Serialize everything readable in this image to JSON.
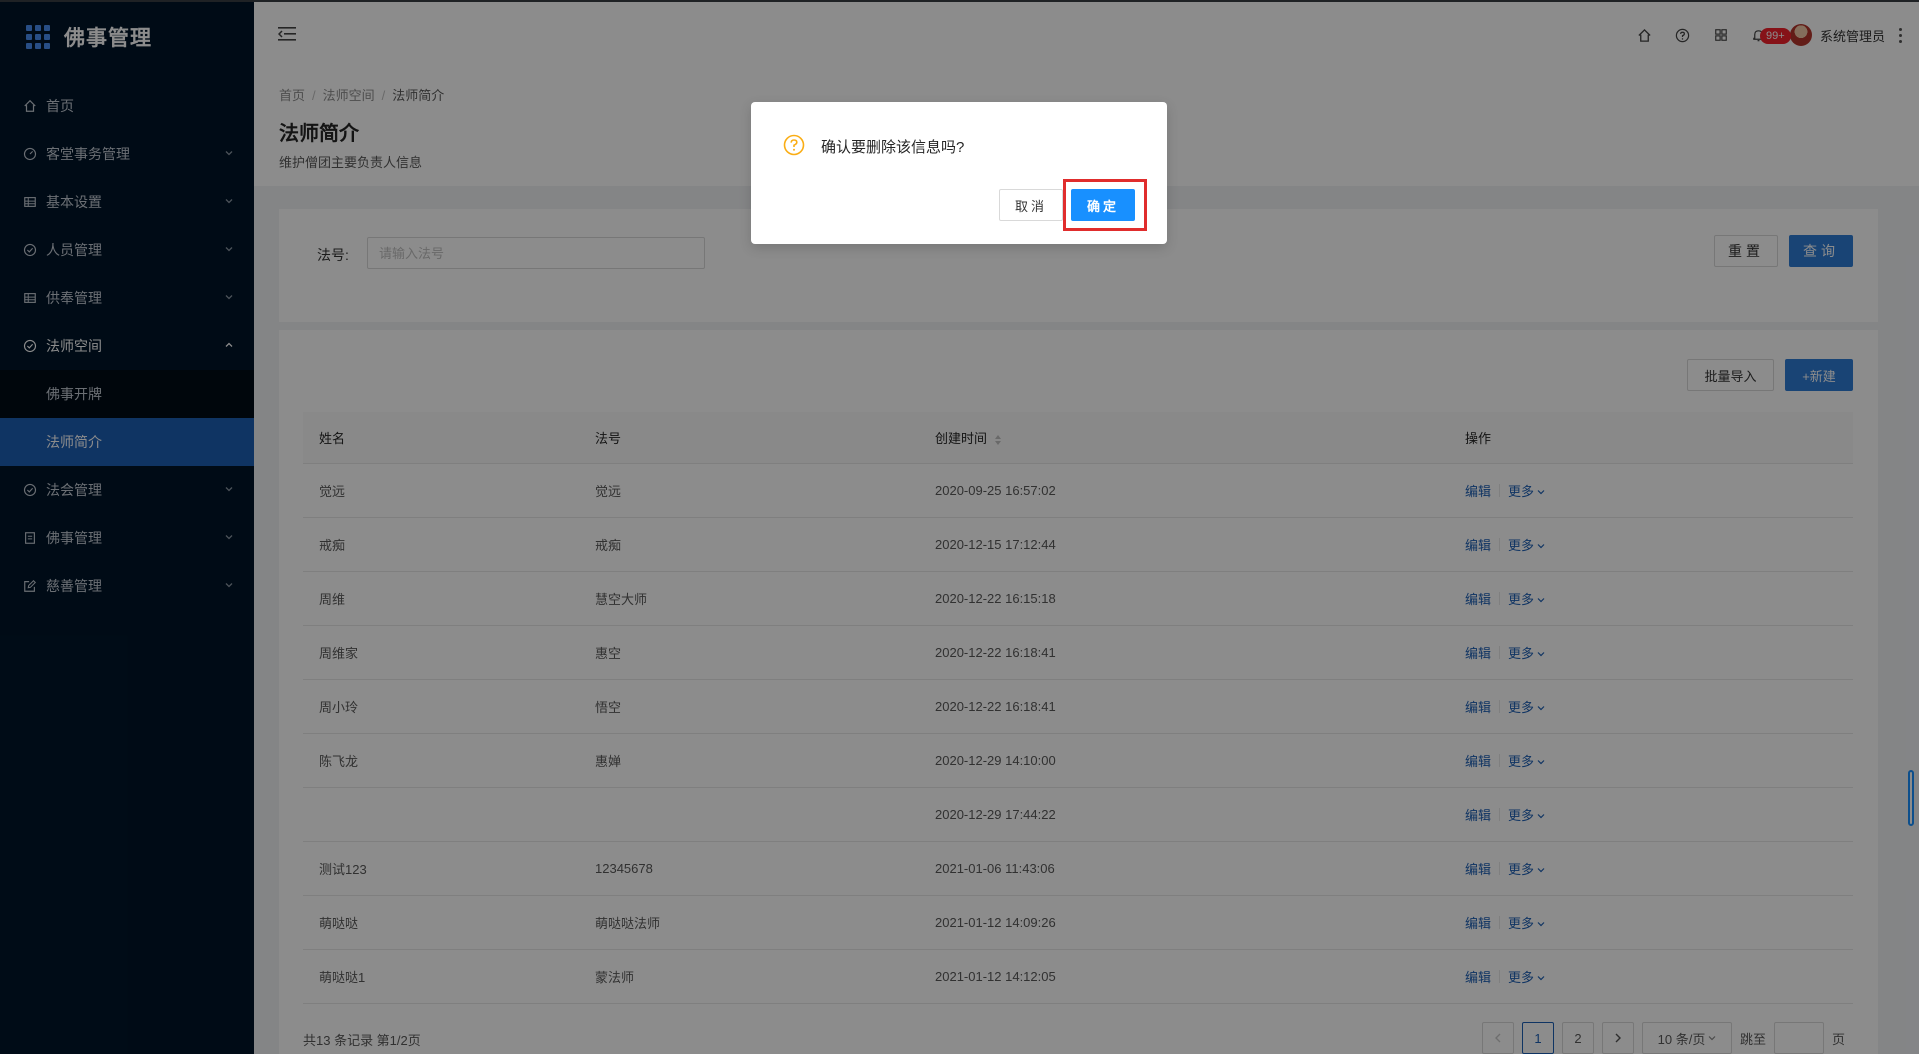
{
  "app": {
    "title": "佛事管理"
  },
  "sidebar": {
    "items": [
      {
        "label": "首页",
        "icon": "home-icon",
        "expandable": false
      },
      {
        "label": "客堂事务管理",
        "icon": "dashboard-icon",
        "expandable": true
      },
      {
        "label": "基本设置",
        "icon": "table-icon",
        "expandable": true
      },
      {
        "label": "人员管理",
        "icon": "check-circle-icon",
        "expandable": true
      },
      {
        "label": "供奉管理",
        "icon": "table-icon",
        "expandable": true
      },
      {
        "label": "法师空间",
        "icon": "check-circle-icon",
        "expandable": true,
        "open": true,
        "children": [
          {
            "label": "佛事开牌",
            "active": false
          },
          {
            "label": "法师简介",
            "active": true
          }
        ]
      },
      {
        "label": "法会管理",
        "icon": "check-circle-icon",
        "expandable": true
      },
      {
        "label": "佛事管理",
        "icon": "profile-icon",
        "expandable": true
      },
      {
        "label": "慈善管理",
        "icon": "edit-icon",
        "expandable": true
      }
    ]
  },
  "header": {
    "notification_count": "99+",
    "username": "系统管理员"
  },
  "breadcrumb": [
    "首页",
    "法师空间",
    "法师简介"
  ],
  "page": {
    "title": "法师简介",
    "description": "维护僧团主要负责人信息"
  },
  "search": {
    "label": "法号:",
    "placeholder": "请输入法号",
    "reset_label": "重置",
    "query_label": "查询"
  },
  "toolbar": {
    "import_label": "批量导入",
    "new_label": "+新建"
  },
  "table": {
    "columns": [
      "姓名",
      "法号",
      "创建时间",
      "操作"
    ],
    "action_edit": "编辑",
    "action_more": "更多",
    "rows": [
      {
        "name": "觉远",
        "dharma": "觉远",
        "created": "2020-09-25 16:57:02"
      },
      {
        "name": "戒痴",
        "dharma": "戒痴",
        "created": "2020-12-15 17:12:44"
      },
      {
        "name": "周维",
        "dharma": "慧空大师",
        "created": "2020-12-22 16:15:18"
      },
      {
        "name": "周维家",
        "dharma": "惠空",
        "created": "2020-12-22 16:18:41"
      },
      {
        "name": "周小玲",
        "dharma": "悟空",
        "created": "2020-12-22 16:18:41"
      },
      {
        "name": "陈飞龙",
        "dharma": "惠婵",
        "created": "2020-12-29 14:10:00"
      },
      {
        "name": "",
        "dharma": "",
        "created": "2020-12-29 17:44:22"
      },
      {
        "name": "测试123",
        "dharma": "12345678",
        "created": "2021-01-06 11:43:06"
      },
      {
        "name": "萌哒哒",
        "dharma": "萌哒哒法师",
        "created": "2021-01-12 14:09:26"
      },
      {
        "name": "萌哒哒1",
        "dharma": "蒙法师",
        "created": "2021-01-12 14:12:05"
      }
    ]
  },
  "pagination": {
    "summary": "共13 条记录 第1/2页",
    "pages": [
      "1",
      "2"
    ],
    "current": "1",
    "page_size": "10 条/页",
    "jump_label": "跳至",
    "page_suffix": "页"
  },
  "modal": {
    "message": "确认要删除该信息吗?",
    "cancel_label": "取消",
    "ok_label": "确定"
  },
  "colors": {
    "sidebar_bg": "#001529",
    "primary": "#1890ff",
    "active_menu": "#1d5fb5",
    "highlight_box": "#e02d2d",
    "warning_icon": "#faad14"
  }
}
